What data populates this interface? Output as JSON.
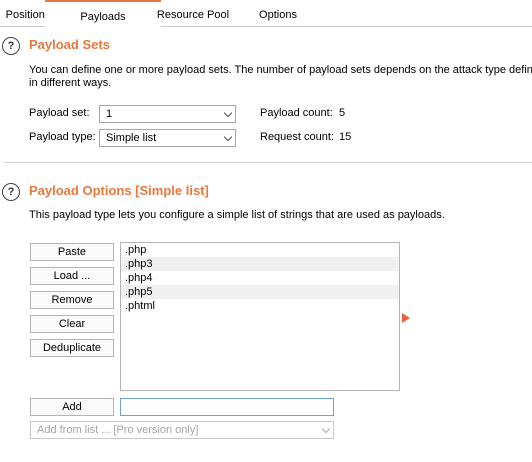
{
  "tabs": [
    {
      "label": "Positions"
    },
    {
      "label": "Payloads"
    },
    {
      "label": "Resource Pool"
    },
    {
      "label": "Options"
    }
  ],
  "payload_sets": {
    "title": "Payload Sets",
    "desc_line1": "You can define one or more payload sets. The number of payload sets depends on the attack type defin",
    "desc_line2": "in different ways.",
    "set_label": "Payload set:",
    "set_value": "1",
    "type_label": "Payload type:",
    "type_value": "Simple list",
    "count_label": "Payload count:",
    "count_value": "5",
    "request_label": "Request count:",
    "request_value": "15"
  },
  "payload_options": {
    "title": "Payload Options [Simple list]",
    "desc": "This payload type lets you configure a simple list of strings that are used as payloads.",
    "buttons": {
      "paste": "Paste",
      "load": "Load ...",
      "remove": "Remove",
      "clear": "Clear",
      "deduplicate": "Deduplicate",
      "add": "Add"
    },
    "items": [
      ".php",
      ".php3",
      ".php4",
      ".php5",
      ".phtml"
    ],
    "add_value": "",
    "add_from_list": "Add from list ... [Pro version only]"
  },
  "help_icon_glyph": "?",
  "accent_color": "#e8773d"
}
